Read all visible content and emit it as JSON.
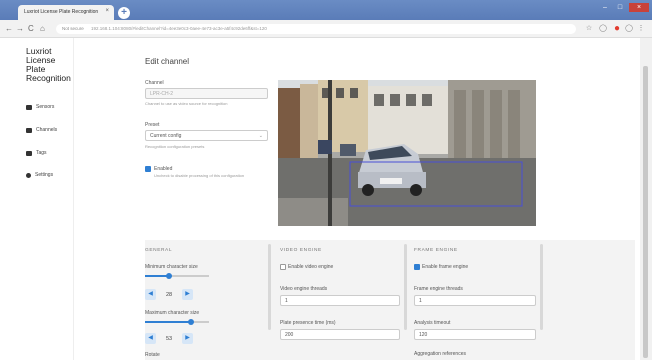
{
  "browser": {
    "tab_title": "Luxriot License Plate Recognition",
    "tab_close": "×",
    "new_tab": "+",
    "nav_back": "←",
    "nav_forward": "→",
    "nav_reload": "C",
    "nav_home": "⌂",
    "secure_label": "Not secure",
    "url": "192.168.1.104:8080/#/editChannel?id=4ee3e0c3-0aee-4e73-ac3e-a5f4c92de6ff&st=120",
    "window_minimize": "–",
    "window_maximize": "□",
    "window_close": "×",
    "ext_star": "☆",
    "ext_adblock": "●",
    "ext_profile": "◯",
    "ext_menu": "⋮"
  },
  "sidebar": {
    "logo": "Luxriot License Plate Recognition",
    "items": [
      {
        "label": "Sensors",
        "icon": "sensors-icon"
      },
      {
        "label": "Channels",
        "icon": "channels-icon"
      },
      {
        "label": "Tags",
        "icon": "tags-icon"
      },
      {
        "label": "Settings",
        "icon": "settings-icon"
      }
    ]
  },
  "page": {
    "title": "Edit channel",
    "channel": {
      "label": "Channel",
      "value": "LPR-CH-2",
      "help": "Channel to use as video source for recognition"
    },
    "preset": {
      "label": "Preset",
      "value": "Current config",
      "help": "Recognition configuration presets"
    },
    "enabled": {
      "label": "Enabled",
      "help": "Uncheck to disable processing of this configuration",
      "checked": true
    }
  },
  "general": {
    "title": "GENERAL",
    "min_char_label": "Minimum character size",
    "min_char_value": "28",
    "min_slider_level": 0.38,
    "max_char_label": "Maximum character size",
    "max_char_value": "53",
    "max_slider_level": 0.72,
    "next_label": "Rotate",
    "dec": "◀",
    "inc": "▶"
  },
  "video_engine": {
    "title": "VIDEO ENGINE",
    "enable_label": "Enable video engine",
    "threads_label": "Video engine threads",
    "threads_value": "1",
    "presence_label": "Plate presence time (ms)",
    "presence_value": "200"
  },
  "frame_engine": {
    "title": "FRAME ENGINE",
    "enable_label": "Enable frame engine",
    "threads_label": "Frame engine threads",
    "threads_value": "1",
    "timeout_label": "Analysis timeout",
    "timeout_value": "120",
    "aggregation_label": "Aggregation references"
  },
  "colors": {
    "accent": "#2f7fd3",
    "titlebar": "#5a7cb8",
    "close": "#c9423a"
  }
}
